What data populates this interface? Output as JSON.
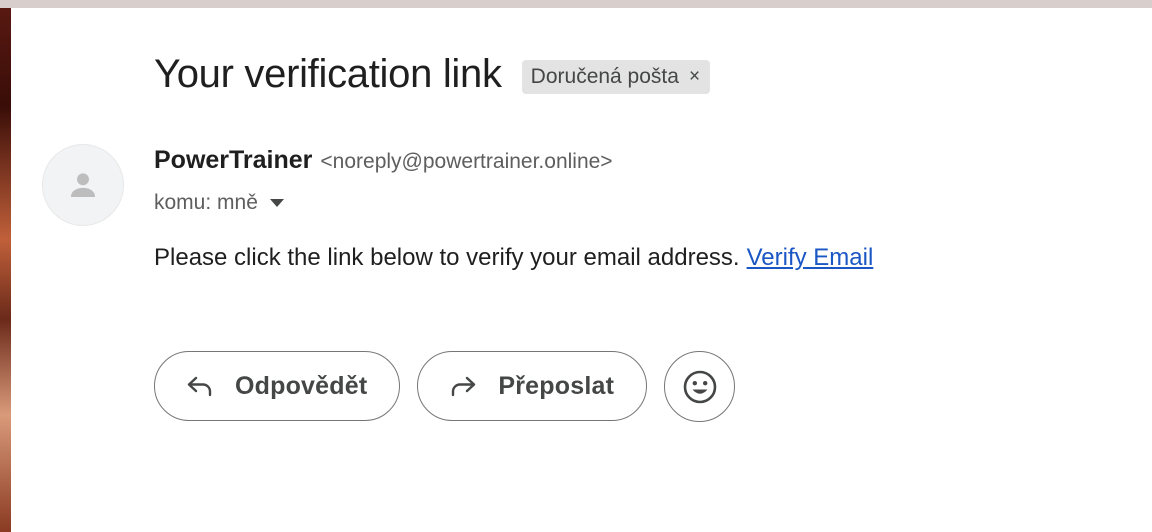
{
  "email": {
    "subject": "Your verification link",
    "label_chip": {
      "text": "Doručená pošta",
      "close_glyph": "×"
    },
    "sender": {
      "name": "PowerTrainer",
      "address": "<noreply@powertrainer.online>",
      "avatar_icon": "person-icon"
    },
    "recipient_label": "komu: mně",
    "body": {
      "text": "Please click the link below to verify your email address.",
      "link_text": "Verify Email"
    }
  },
  "actions": {
    "reply_label": "Odpovědět",
    "forward_label": "Přeposlat",
    "reply_icon": "reply-icon",
    "forward_icon": "forward-icon",
    "emoji_icon": "emoji-icon"
  },
  "colors": {
    "link": "#1a56c4",
    "chip_bg": "#e3e3e3",
    "text": "#1f1f1f",
    "muted": "#5e5e5e"
  }
}
